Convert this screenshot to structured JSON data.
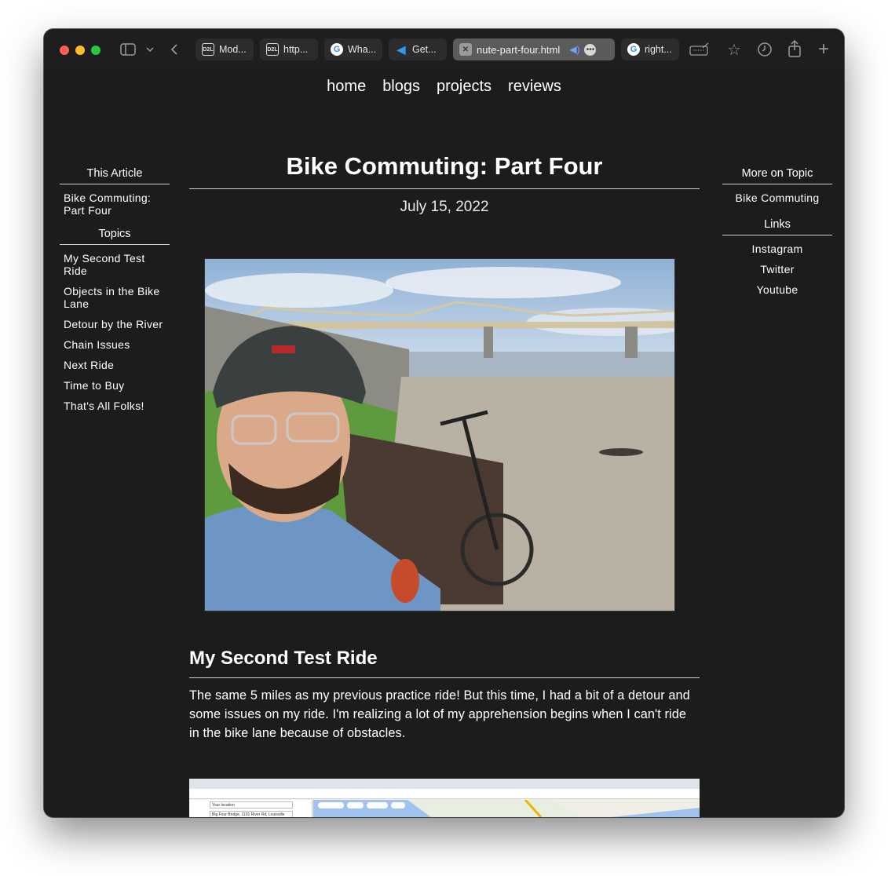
{
  "browser": {
    "tabs": [
      {
        "label": "Mod...",
        "icon": "d2l-icon"
      },
      {
        "label": "http...",
        "icon": "d2l-icon"
      },
      {
        "label": "Wha...",
        "icon": "google-icon"
      },
      {
        "label": "Get...",
        "icon": "vscode-icon"
      },
      {
        "label": "nute-part-four.html",
        "icon": "close-icon",
        "active": true
      },
      {
        "label": "right...",
        "icon": "google-icon"
      }
    ]
  },
  "nav": [
    "home",
    "blogs",
    "projects",
    "reviews"
  ],
  "article": {
    "title": "Bike Commuting: Part Four",
    "date": "July 15, 2022",
    "section_title": "My Second Test Ride",
    "section_text": "The same 5 miles as my previous practice ride! But this time, I had a bit of a detour and some issues on my ride. I'm realizing a lot of my apprehension begins when I can't ride in the bike lane because of obstacles."
  },
  "left_sidebar": {
    "this_article_heading": "This Article",
    "this_article_items": [
      "Bike Commuting: Part Four"
    ],
    "topics_heading": "Topics",
    "topics": [
      "My Second Test Ride",
      "Objects in the Bike Lane",
      "Detour by the River",
      "Chain Issues",
      "Next Ride",
      "Time to Buy",
      "That's All Folks!"
    ]
  },
  "right_sidebar": {
    "more_heading": "More on Topic",
    "more_items": [
      "Bike Commuting"
    ],
    "links_heading": "Links",
    "links": [
      "Instagram",
      "Twitter",
      "Youtube"
    ]
  },
  "embedded_screenshot": {
    "your_location": "Your location",
    "destination": "Big Four Bridge, 1101 River Rd, Louisville",
    "chips": [
      "Restaurants",
      "Coffee",
      "Groceries",
      "More"
    ]
  }
}
